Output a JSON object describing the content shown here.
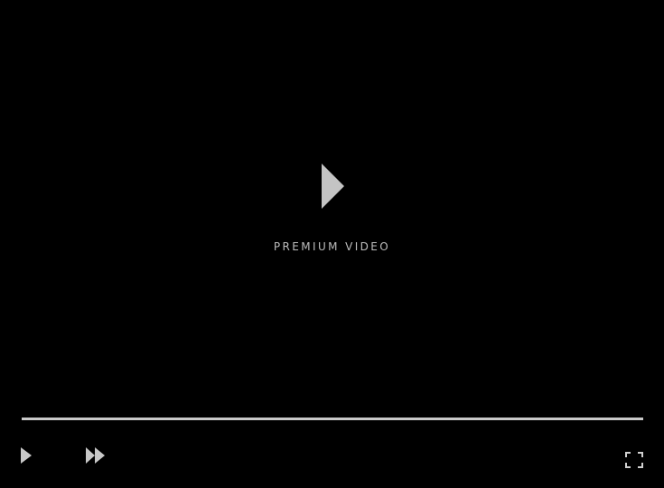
{
  "player": {
    "overlay_label": "PREMIUM VIDEO",
    "progress_fraction": 0,
    "colors": {
      "background": "#000000",
      "icon": "#c0c0c0",
      "progress_track": "#c9c9c9",
      "label": "#bdbdbd"
    },
    "icons": {
      "center": "play-icon",
      "play": "play-icon",
      "forward": "fast-forward-icon",
      "fullscreen": "fullscreen-icon"
    }
  }
}
